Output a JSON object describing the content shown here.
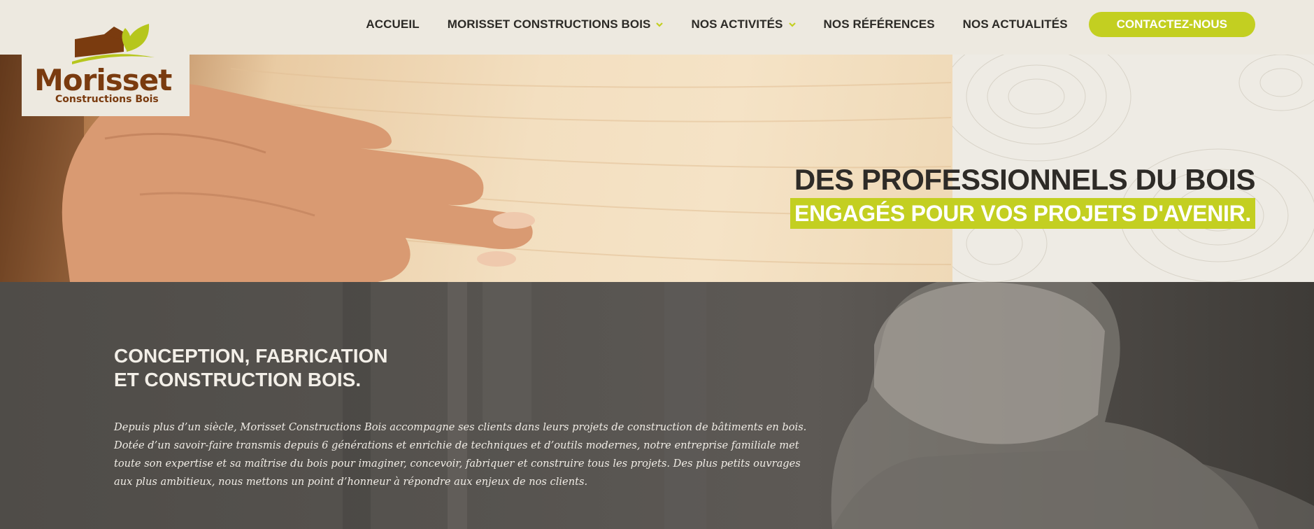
{
  "brand": {
    "name": "Morisset",
    "subtitle": "Constructions Bois",
    "colors": {
      "primary": "#7a3b0f",
      "accent": "#c3cf21",
      "text": "#2c2a26"
    }
  },
  "nav": {
    "items": [
      {
        "label": "ACCUEIL",
        "has_dropdown": false
      },
      {
        "label": "MORISSET CONSTRUCTIONS BOIS",
        "has_dropdown": true
      },
      {
        "label": "NOS ACTIVITÉS",
        "has_dropdown": true
      },
      {
        "label": "NOS RÉFÉRENCES",
        "has_dropdown": false
      },
      {
        "label": "NOS ACTUALITÉS",
        "has_dropdown": false
      }
    ],
    "cta": "CONTACTEZ-NOUS"
  },
  "hero": {
    "line1": "DES PROFESSIONNELS DU BOIS",
    "line2": "ENGAGÉS POUR VOS PROJETS D'AVENIR."
  },
  "intro": {
    "title_lines": [
      "CONCEPTION, FABRICATION",
      "ET CONSTRUCTION BOIS."
    ],
    "paragraph_lines": [
      "Depuis plus d’un siècle, Morisset Constructions Bois accompagne ses clients dans leurs projets de construction de bâtiments en bois.",
      "Dotée d’un savoir-faire transmis depuis 6 générations et enrichie de techniques et d’outils modernes, notre entreprise familiale met",
      "toute son expertise et sa maîtrise du bois pour imaginer, concevoir, fabriquer et construire tous les projets. Des plus petits ouvrages",
      "aux plus ambitieux, nous mettons un point d’honneur à répondre aux enjeux de nos clients."
    ]
  },
  "icons": {
    "dropdown": "chevron-down-icon",
    "logo": "house-leaf-logo-icon"
  }
}
